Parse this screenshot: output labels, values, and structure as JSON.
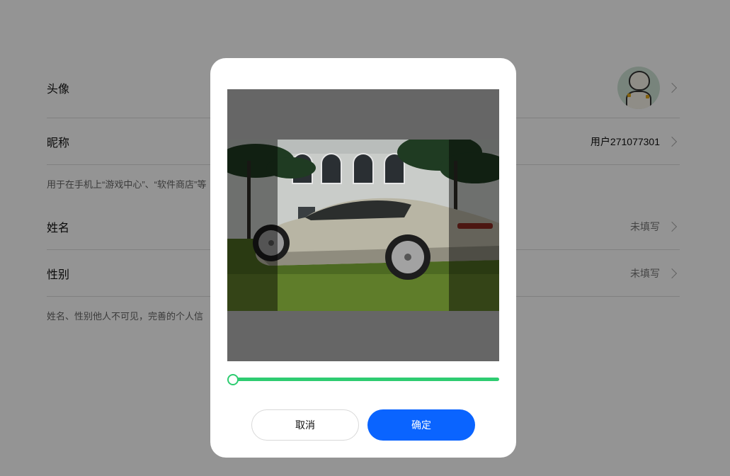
{
  "settings": {
    "rows": [
      {
        "label": "头像",
        "value": ""
      },
      {
        "label": "昵称",
        "value": "用户271077301"
      },
      {
        "label": "姓名",
        "value": "未填写"
      },
      {
        "label": "性别",
        "value": "未填写"
      }
    ],
    "hint_nickname": "用于在手机上“游戏中心”、“软件商店”等",
    "hint_privacy": "姓名、性别他人不可见，完善的个人信"
  },
  "modal": {
    "zoom_level": 0,
    "cancel_label": "取消",
    "confirm_label": "确定"
  },
  "colors": {
    "accent_green": "#2ecc71",
    "primary_blue": "#0a64ff",
    "overlay": "rgba(0,0,0,0.42)"
  },
  "icons": [
    "chevron-right-icon",
    "avatar-image"
  ]
}
